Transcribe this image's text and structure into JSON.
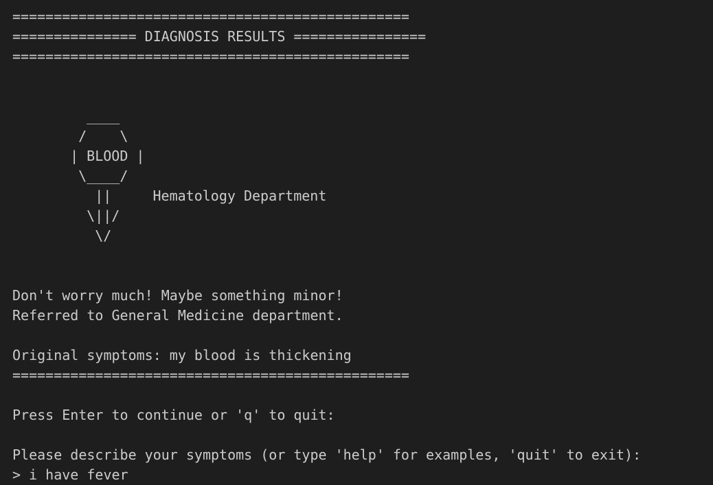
{
  "terminal": {
    "separator": "================================================",
    "header_title": "=============== DIAGNOSIS RESULTS ================",
    "art": {
      "line1": "    ____",
      "line2": "   /    \\",
      "line3": "  | BLOOD |",
      "line4": "   \\____/",
      "line5": "     ||     Hematology Department",
      "line6": "    \\||/",
      "line7": "     \\/"
    },
    "message_1": "Don't worry much! Maybe something minor!",
    "message_2": "Referred to General Medicine department.",
    "original_symptoms": "Original symptoms: my blood is thickening",
    "continue_prompt": "Press Enter to continue or 'q' to quit:",
    "describe_prompt": "Please describe your symptoms (or type 'help' for examples, 'quit' to exit):",
    "input_line": "> i have fever"
  }
}
